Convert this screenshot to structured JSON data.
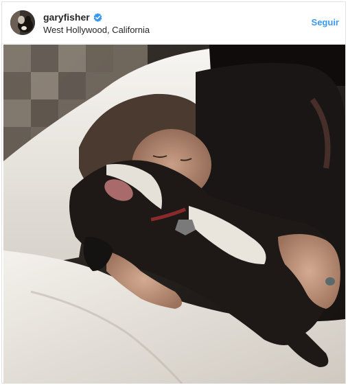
{
  "post": {
    "username": "garyfisher",
    "location": "West Hollywood, California",
    "follow_label": "Seguir",
    "verified": true
  },
  "colors": {
    "accent": "#3897f0",
    "text": "#262626",
    "border": "#e2e2e2"
  },
  "icons": {
    "verified": "verified-badge-icon",
    "avatar": "profile-photo-dog"
  },
  "photo": {
    "subject": "woman-asleep-with-dog-on-bed"
  }
}
